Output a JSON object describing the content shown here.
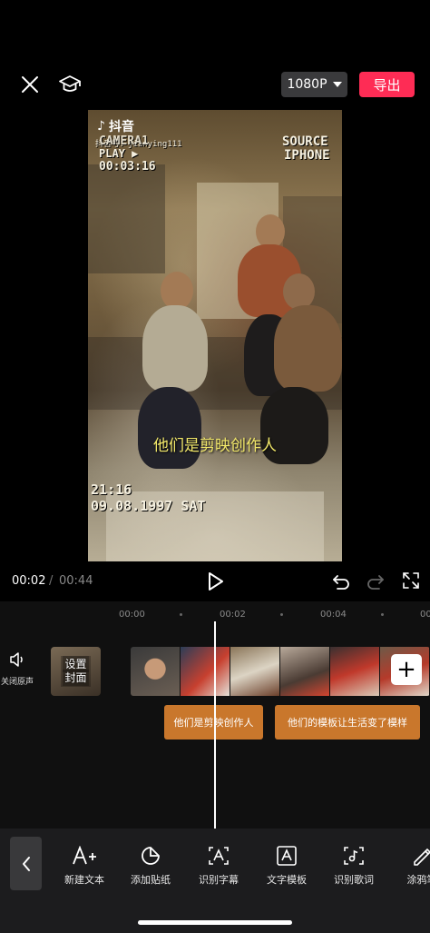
{
  "header": {
    "close_icon": "close-icon",
    "tutorial_icon": "graduation-cap-icon",
    "resolution": "1080P",
    "export_label": "导出",
    "accent": "#fe2c55"
  },
  "preview": {
    "tiktok_brand": "抖音",
    "tiktok_user": "抖音号：jianying111",
    "camera_text": "CAMERA1",
    "play_text": "PLAY ▶",
    "tape_time": "00:03:16",
    "source_text": "SOURCE",
    "device_text": "IPHONE",
    "subtitle": "他们是剪映创作人",
    "clock": "21:16",
    "date": "09.08.1997 SAT"
  },
  "playback": {
    "current": "00:02",
    "separator": "/",
    "total": "00:44"
  },
  "timeline": {
    "ruler": [
      "00:00",
      "00:02",
      "00:04",
      "00"
    ],
    "mute_label": "关闭原声",
    "cover_label_line1": "设置",
    "cover_label_line2": "封面",
    "text_clips": [
      "他们是剪映创作人",
      "他们的模板让生活变了模样"
    ],
    "clip_color": "#c9772c"
  },
  "toolbar": {
    "items": [
      {
        "label": "新建文本",
        "icon": "text-add-icon"
      },
      {
        "label": "添加贴纸",
        "icon": "sticker-icon"
      },
      {
        "label": "识别字幕",
        "icon": "caption-recognize-icon"
      },
      {
        "label": "文字模板",
        "icon": "text-template-icon"
      },
      {
        "label": "识别歌词",
        "icon": "lyrics-recognize-icon"
      },
      {
        "label": "涂鸦笔",
        "icon": "brush-icon"
      }
    ]
  }
}
